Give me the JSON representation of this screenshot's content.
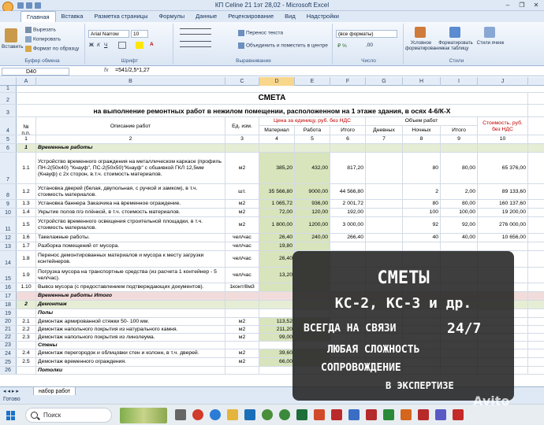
{
  "window": {
    "title": "КП Celine 21 1эт 28,02 - Microsoft Excel",
    "controls": [
      "–",
      "❐",
      "✕"
    ]
  },
  "ribbon_tabs": [
    "Главная",
    "Вставка",
    "Разметка страницы",
    "Формулы",
    "Данные",
    "Рецензирование",
    "Вид",
    "Надстройки"
  ],
  "ribbon": {
    "paste_label": "Вставить",
    "cut_label": "Вырезать",
    "copy_label": "Копировать",
    "format_painter_label": "Формат по образцу",
    "clipboard_group": "Буфер обмена",
    "font_name": "Arial Narrow",
    "font_size": "10",
    "font_group": "Шрифт",
    "wrap_text_label": "Перенос текста",
    "merge_label": "Объединить и поместить в центре",
    "alignment_group": "Выравнивание",
    "number_format": "(все форматы)",
    "number_group": "Число",
    "conditional_format_label": "Условное форматирование",
    "format_as_table_label": "Форматировать как таблицу",
    "cell_styles_label": "Стили ячеек",
    "styles_group": "Стили"
  },
  "formula_bar": {
    "cell_ref": "D40",
    "fx": "fx",
    "formula": "=541/2,5*1,27"
  },
  "columns": [
    "A",
    "B",
    "C",
    "D",
    "E",
    "F",
    "G",
    "H",
    "I",
    "J"
  ],
  "selected_column": "D",
  "sheet": {
    "title": "СМЕТА",
    "subtitle": "на выполнение ремонтных работ в нежилом помещении, расположенном на 1 этаже здания, в осях 4-6/К-Х",
    "header": {
      "num": "№ п.п.",
      "desc": "Описание работ",
      "unit": "Ед. изм.",
      "price_group": "Цена за единицу, руб. без НДС",
      "material": "Материал",
      "work": "Работа",
      "total": "Итого",
      "volume_group": "Объем работ",
      "day": "Дневных",
      "night": "Ночных",
      "vol_total": "Итого",
      "cost": "Стоимость, руб. без НДС",
      "numbers": [
        "1",
        "2",
        "3",
        "4",
        "5",
        "6",
        "7",
        "8",
        "9",
        "10"
      ]
    },
    "rows": [
      {
        "r": "6",
        "num": "1",
        "desc": "Временные работы",
        "unit": "",
        "d": "",
        "e": "",
        "f": "",
        "g": "",
        "h": "",
        "i": "",
        "j": "",
        "style": "section"
      },
      {
        "r": "7",
        "num": "1.1",
        "desc": "Устройство временного ограждения на металлическом каркасе (профиль ПН-2(50х40) \"Кнауф\", ПС-2(50х50)\"Кнауф\" с обшивкой ГКЛ 12,5мм (Кнауф) с 2х сторон, в.т.ч. стоимость материалов.",
        "unit": "м2",
        "d": "385,20",
        "e": "432,00",
        "f": "817,20",
        "g": "",
        "h": "80",
        "i": "80,00",
        "j": "65 376,00",
        "style": ""
      },
      {
        "r": "8",
        "num": "1.2",
        "desc": "Установка дверей (белая, двупольная, с ручкой и замком), в т.ч. стоимость материалов.",
        "unit": "шт.",
        "d": "35 566,80",
        "e": "9000,00",
        "f": "44 566,80",
        "g": "",
        "h": "2",
        "i": "2,00",
        "j": "89 133,60",
        "style": ""
      },
      {
        "r": "9",
        "num": "1.3",
        "desc": "Установка баннера Заказчика на временное ограждение.",
        "unit": "м2",
        "d": "1 065,72",
        "e": "936,00",
        "f": "2 001,72",
        "g": "",
        "h": "80",
        "i": "80,00",
        "j": "160 137,60",
        "style": ""
      },
      {
        "r": "10",
        "num": "1.4",
        "desc": "Укрытие полов п/э плёнкой, в т.ч. стоимость материалов.",
        "unit": "м2",
        "d": "72,00",
        "e": "120,00",
        "f": "192,00",
        "g": "",
        "h": "100",
        "i": "100,00",
        "j": "19 200,00",
        "style": ""
      },
      {
        "r": "11",
        "num": "1.5",
        "desc": "Устройство временного освещения строительной площадки, в т.ч. стоимость материалов.",
        "unit": "м2",
        "d": "1 800,00",
        "e": "1200,00",
        "f": "3 000,00",
        "g": "",
        "h": "92",
        "i": "92,00",
        "j": "276 000,00",
        "style": ""
      },
      {
        "r": "12",
        "num": "1.6",
        "desc": "Такелажные работы.",
        "unit": "чел/час",
        "d": "26,40",
        "e": "240,00",
        "f": "266,40",
        "g": "",
        "h": "40",
        "i": "40,00",
        "j": "10 656,00",
        "style": ""
      },
      {
        "r": "13",
        "num": "1.7",
        "desc": "Разборка помещений от мусора.",
        "unit": "чел/час",
        "d": "19,80",
        "e": "",
        "f": "",
        "g": "",
        "h": "",
        "i": "",
        "j": "",
        "style": ""
      },
      {
        "r": "14",
        "num": "1.8",
        "desc": "Перенос демонтированных материалов и мусора к месту загрузки контейнеров.",
        "unit": "чел/час",
        "d": "26,40",
        "e": "",
        "f": "",
        "g": "",
        "h": "",
        "i": "",
        "j": "",
        "style": ""
      },
      {
        "r": "15",
        "num": "1.9",
        "desc": "Погрузка мусора на транспортные средства (из расчета 1 контейнер - 5 чел/час).",
        "unit": "чел/час",
        "d": "13,20",
        "e": "",
        "f": "",
        "g": "",
        "h": "",
        "i": "",
        "j": "",
        "style": ""
      },
      {
        "r": "16",
        "num": "1.10",
        "desc": "Вывоз мусора (с предоставлением подтверждающих документов).",
        "unit": "1конт/8м3",
        "d": "",
        "e": "",
        "f": "",
        "g": "",
        "h": "",
        "i": "",
        "j": "",
        "style": ""
      },
      {
        "r": "17",
        "num": "",
        "desc": "Временные работы Итого",
        "unit": "",
        "d": "",
        "e": "",
        "f": "",
        "g": "",
        "h": "",
        "i": "",
        "j": "",
        "style": "total"
      },
      {
        "r": "18",
        "num": "2",
        "desc": "Демонтаж",
        "unit": "",
        "d": "",
        "e": "",
        "f": "",
        "g": "",
        "h": "",
        "i": "",
        "j": "",
        "style": "section"
      },
      {
        "r": "19",
        "num": "",
        "desc": "Полы",
        "unit": "",
        "d": "",
        "e": "",
        "f": "",
        "g": "",
        "h": "",
        "i": "",
        "j": "",
        "style": "sub"
      },
      {
        "r": "20",
        "num": "2.1",
        "desc": "Демонтаж армированной стяжки 50- 100 мм.",
        "unit": "м2",
        "d": "113,52",
        "e": "",
        "f": "",
        "g": "",
        "h": "",
        "i": "",
        "j": "",
        "style": ""
      },
      {
        "r": "21",
        "num": "2.2",
        "desc": "Демонтаж напольного покрытия из натурального камня.",
        "unit": "м2",
        "d": "211,20",
        "e": "",
        "f": "",
        "g": "",
        "h": "",
        "i": "",
        "j": "",
        "style": ""
      },
      {
        "r": "22",
        "num": "2.3",
        "desc": "Демонтаж напольного покрытия из линолеума.",
        "unit": "м2",
        "d": "99,00",
        "e": "",
        "f": "",
        "g": "",
        "h": "",
        "i": "",
        "j": "",
        "style": ""
      },
      {
        "r": "23",
        "num": "",
        "desc": "Стены",
        "unit": "",
        "d": "",
        "e": "",
        "f": "",
        "g": "",
        "h": "",
        "i": "",
        "j": "",
        "style": "sub"
      },
      {
        "r": "24",
        "num": "2.4",
        "desc": "Демонтаж перегородок и облицовки стен и колонн, в т.ч. дверей.",
        "unit": "м2",
        "d": "39,60",
        "e": "",
        "f": "",
        "g": "",
        "h": "",
        "i": "",
        "j": "",
        "style": ""
      },
      {
        "r": "25",
        "num": "2.5",
        "desc": "Демонтаж временного ограждения.",
        "unit": "м2",
        "d": "66,00",
        "e": "",
        "f": "",
        "g": "",
        "h": "",
        "i": "",
        "j": "",
        "style": ""
      },
      {
        "r": "26",
        "num": "",
        "desc": "Потолки",
        "unit": "",
        "d": "",
        "e": "",
        "f": "",
        "g": "",
        "h": "",
        "i": "",
        "j": "",
        "style": "sub"
      }
    ]
  },
  "sheet_tab": "набор работ",
  "status": "Готово",
  "taskbar": {
    "search_label": "Поиск"
  },
  "overlay": {
    "line1": "СМЕТЫ",
    "line2": "КС-2, КС-3 и др.",
    "line3a": "ВСЕГДА НА СВЯЗИ",
    "line3b": "24/7",
    "line4": "ЛЮБАЯ СЛОЖНОСТЬ",
    "line5": "СОПРОВОЖДЕНИЕ",
    "line6": "В ЭКСПЕРТИЗЕ"
  },
  "watermark": "Avito",
  "colors": {
    "accent": "#c00000",
    "header_bg": "#e4ecf7",
    "price_fill": "#d8e4bc",
    "total_fill": "#f2dcdb"
  }
}
